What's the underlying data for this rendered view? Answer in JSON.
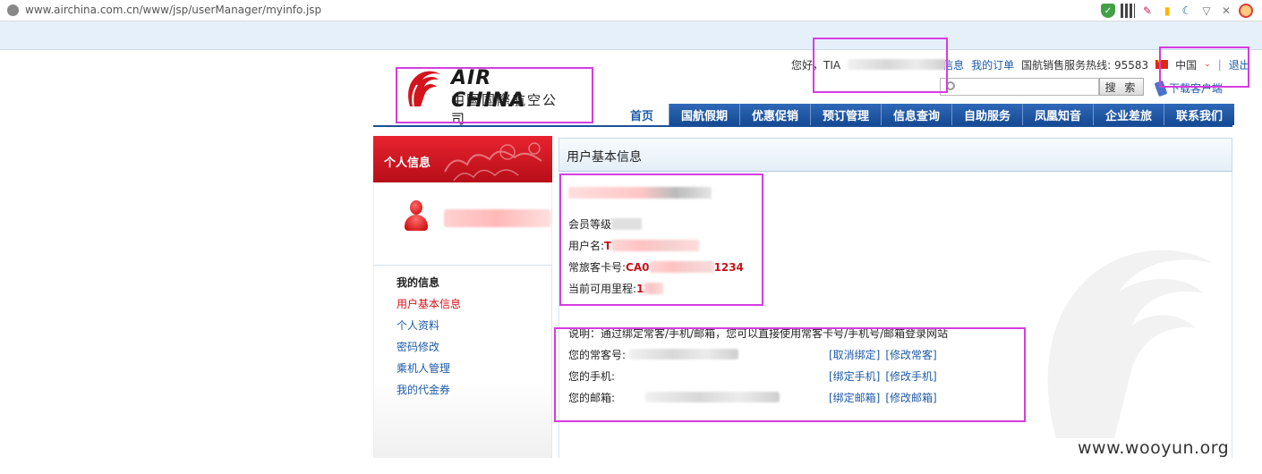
{
  "browser": {
    "url": "www.airchina.com.cn/www/jsp/userManager/myinfo.jsp"
  },
  "header": {
    "logo_en": "AIR CHINA",
    "logo_cn": "中国国際航空公司",
    "greeting": "您好，TIA",
    "info_link_tail": "信息",
    "my_orders": "我的订单",
    "hotline": "国航销售服务热线: 95583",
    "language": "中国",
    "separator": "|",
    "logout": "退出",
    "search_button": "搜 索",
    "search_placeholder": "",
    "download_app": "下载客户端"
  },
  "nav": {
    "home": "首页",
    "items": [
      "国航假期",
      "优惠促销",
      "预订管理",
      "信息查询",
      "自助服务",
      "凤凰知音",
      "企业差旅",
      "联系我们"
    ]
  },
  "sidebar": {
    "header": "个人信息",
    "menu_title": "我的信息",
    "items": [
      "用户基本信息",
      "个人资料",
      "密码修改",
      "乘机人管理",
      "我的代金券"
    ],
    "active_index": 0
  },
  "main": {
    "title": "用户基本信息",
    "member_level_label": "会员等级",
    "username_label": "用户名:",
    "username_value_prefix": "T",
    "card_label": "常旅客卡号:",
    "card_prefix": "CA0",
    "card_suffix": "1234",
    "miles_label": "当前可用里程:",
    "miles_value": "1",
    "note": "说明：通过绑定常客/手机/邮箱，您可以直接使用常客卡号/手机号/邮箱登录网站",
    "bindings": [
      {
        "label": "您的常客号:",
        "actions": [
          "[取消绑定]",
          "[修改常客]"
        ]
      },
      {
        "label": "您的手机:",
        "actions": [
          "[绑定手机]",
          "[修改手机]"
        ]
      },
      {
        "label": "您的邮箱:",
        "actions": [
          "[绑定邮箱]",
          "[修改邮箱]"
        ]
      }
    ]
  },
  "watermark_text": "www.wooyun.org",
  "colors": {
    "brand_red": "#d4141c",
    "nav_blue": "#1d4f9b",
    "link_blue": "#1d5aa8",
    "annotation": "#d63ce0"
  }
}
